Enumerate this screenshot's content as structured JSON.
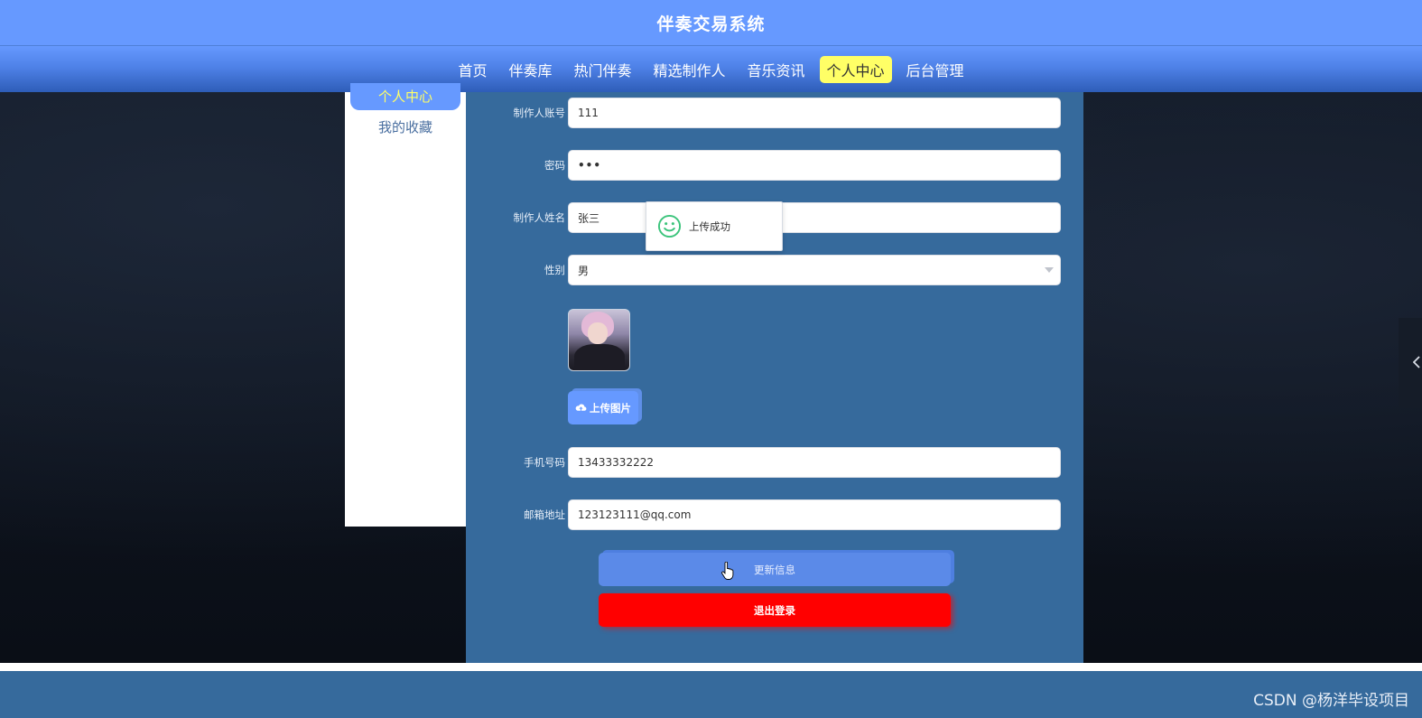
{
  "header": {
    "title": "伴奏交易系统"
  },
  "nav": {
    "items": [
      {
        "label": "首页"
      },
      {
        "label": "伴奏库"
      },
      {
        "label": "热门伴奏"
      },
      {
        "label": "精选制作人"
      },
      {
        "label": "音乐资讯"
      },
      {
        "label": "个人中心",
        "active": true
      },
      {
        "label": "后台管理"
      }
    ]
  },
  "side_menu": {
    "active_label": "个人中心",
    "items": [
      {
        "label": "我的收藏"
      }
    ]
  },
  "form": {
    "account": {
      "label": "制作人账号",
      "value": "111"
    },
    "password": {
      "label": "密码",
      "value": "•••"
    },
    "name": {
      "label": "制作人姓名",
      "value": "张三"
    },
    "gender": {
      "label": "性别",
      "value": "男"
    },
    "upload_label": "上传图片",
    "phone": {
      "label": "手机号码",
      "value": "13433332222"
    },
    "email": {
      "label": "邮箱地址",
      "value": "123123111@qq.com"
    },
    "update_label": "更新信息",
    "logout_label": "退出登录"
  },
  "toast": {
    "message": "上传成功",
    "icon": "smile-icon"
  },
  "footer": {
    "watermark": "CSDN @杨洋毕设项目"
  },
  "colors": {
    "header": "#6699ff",
    "active_nav": "#ffff66",
    "panel": "#366a9c",
    "logout": "#ff0000",
    "toast_icon": "#3cc47c"
  }
}
